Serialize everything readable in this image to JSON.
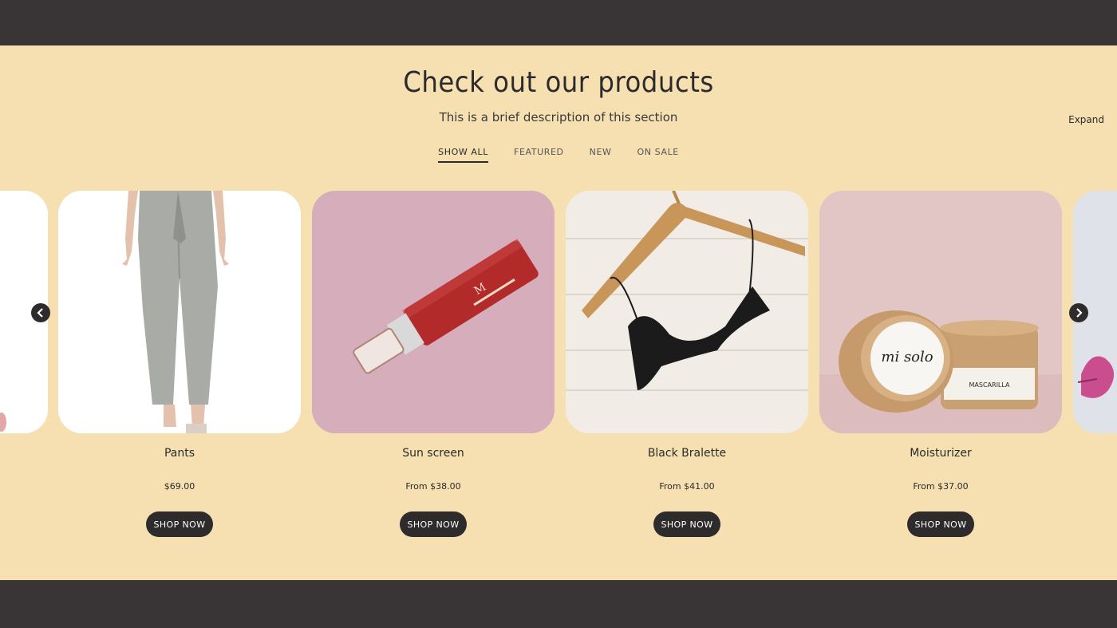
{
  "section": {
    "title": "Check out our products",
    "description": "This is a brief description of this section",
    "expand_label": "Expand"
  },
  "tabs": [
    {
      "label": "SHOW ALL",
      "active": true
    },
    {
      "label": "FEATURED",
      "active": false
    },
    {
      "label": "NEW",
      "active": false
    },
    {
      "label": "ON SALE",
      "active": false
    }
  ],
  "products": [
    {
      "name": "Pants",
      "price": "$69.00",
      "button": "SHOP NOW"
    },
    {
      "name": "Sun screen",
      "price": "From $38.00",
      "button": "SHOP NOW"
    },
    {
      "name": "Black Bralette",
      "price": "From $41.00",
      "button": "SHOP NOW"
    },
    {
      "name": "Moisturizer",
      "price": "From $37.00",
      "button": "SHOP NOW"
    }
  ],
  "product_images": {
    "sunscreen_label": "M",
    "moisturizer_brand": "mi solo",
    "moisturizer_label": "MASCARILLA"
  },
  "colors": {
    "section_bg": "#f6e0b2",
    "page_bg": "#393536",
    "button_bg": "#2d2b2c",
    "text": "#2b2b2b"
  },
  "icons": {
    "prev": "chevron-left-icon",
    "next": "chevron-right-icon"
  }
}
